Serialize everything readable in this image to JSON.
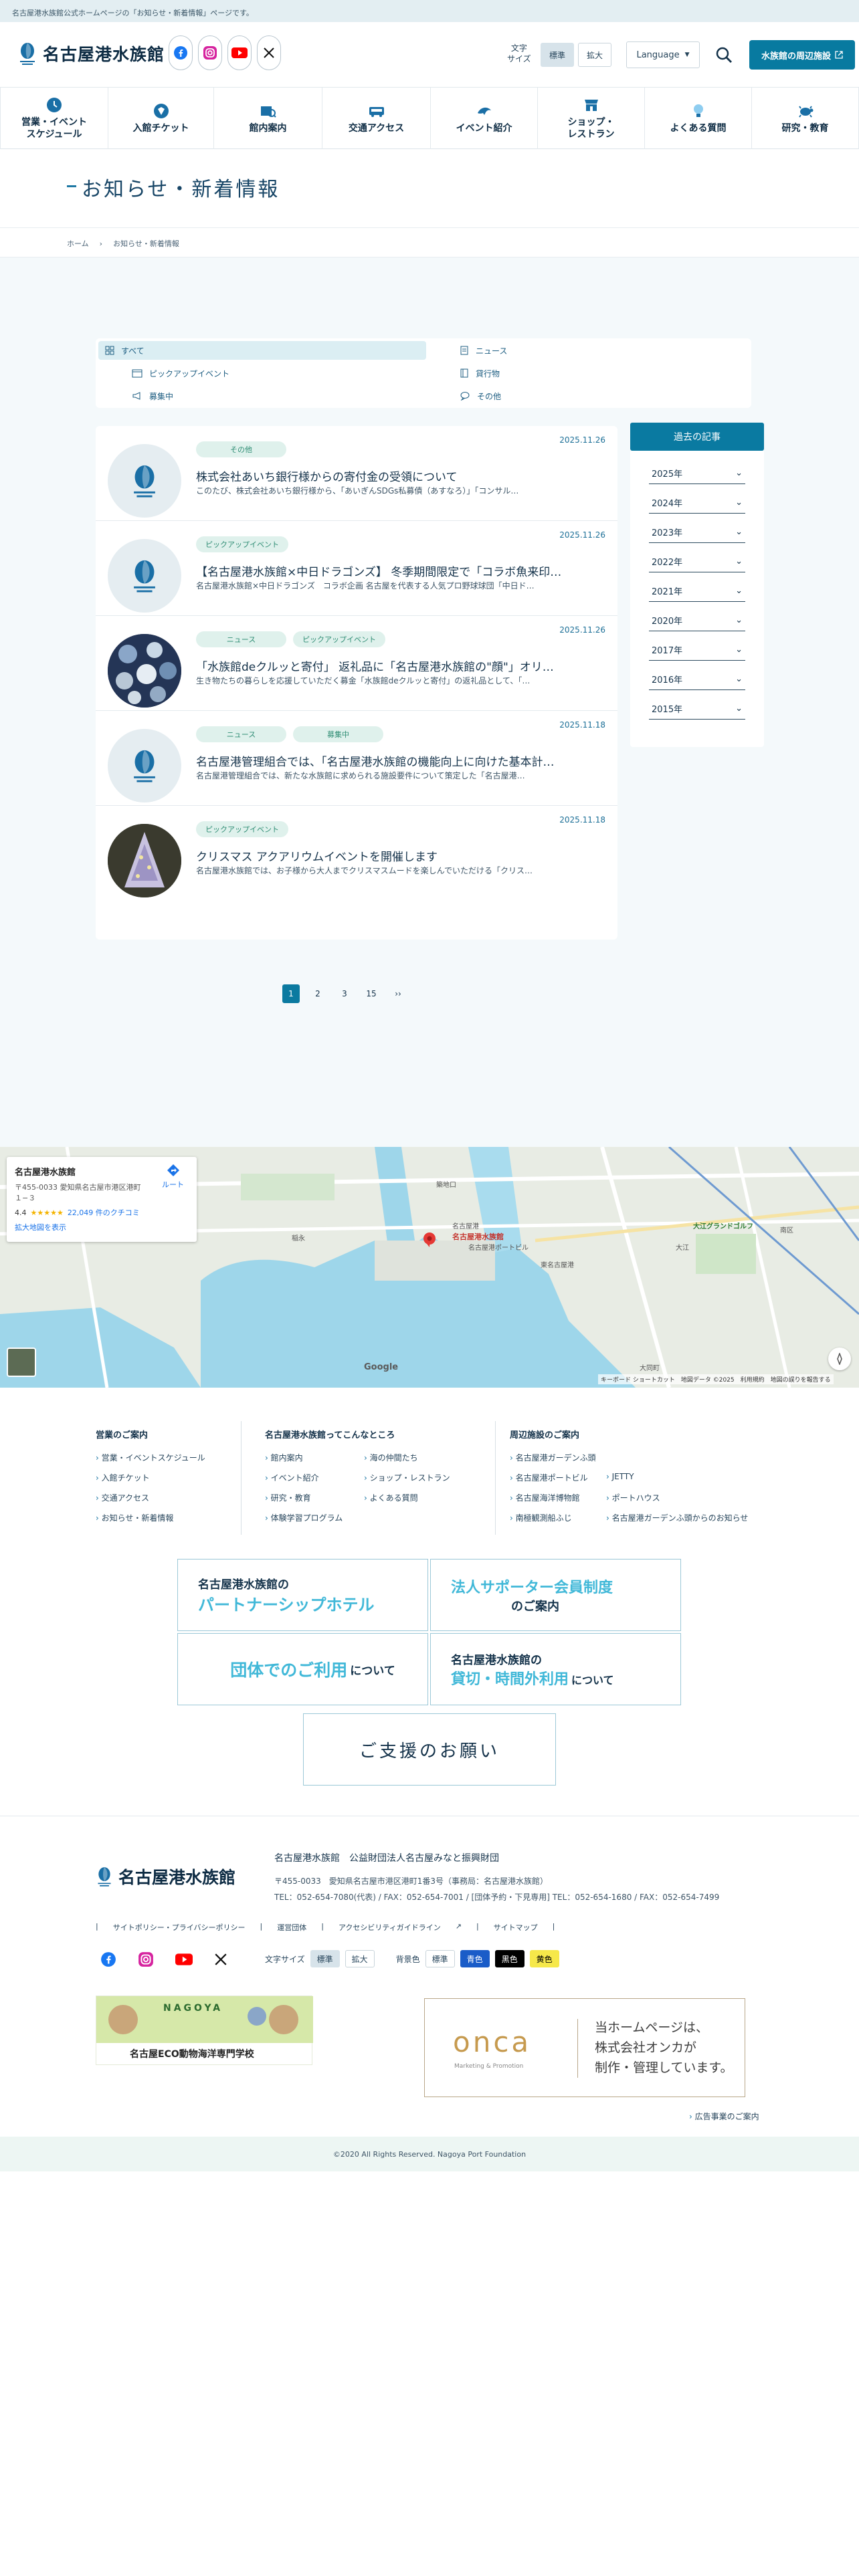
{
  "notice": "名古屋港水族館公式ホームページの「お知らせ・新着情報」ページです。",
  "header": {
    "logo_text": "名古屋港水族館",
    "font_size_label_1": "文字",
    "font_size_label_2": "サイズ",
    "font_size_standard": "標準",
    "font_size_large": "拡大",
    "language": "Language",
    "nearby": "水族館の周辺施設"
  },
  "nav": [
    {
      "l1": "営業・イベント",
      "l2": "スケジュール",
      "icon": "clock-icon"
    },
    {
      "l1": "入館チケット",
      "l2": "",
      "icon": "ticket-icon"
    },
    {
      "l1": "館内案内",
      "l2": "",
      "icon": "map-search-icon"
    },
    {
      "l1": "交通アクセス",
      "l2": "",
      "icon": "bus-icon"
    },
    {
      "l1": "イベント紹介",
      "l2": "",
      "icon": "dolphin-icon"
    },
    {
      "l1": "ショップ・",
      "l2": "レストラン",
      "icon": "shop-icon"
    },
    {
      "l1": "よくある質問",
      "l2": "",
      "icon": "lightbulb-icon"
    },
    {
      "l1": "研究・教育",
      "l2": "",
      "icon": "turtle-icon"
    }
  ],
  "page_title": "お知らせ・新着情報",
  "breadcrumb": [
    "ホーム",
    "お知らせ・新着情報"
  ],
  "filters": [
    {
      "label": "すべて",
      "icon": "grid-icon",
      "active": true
    },
    {
      "label": "ニュース",
      "icon": "document-icon",
      "active": false
    },
    {
      "label": "ピックアップイベント",
      "icon": "calendar-icon",
      "active": false
    },
    {
      "label": "貸行物",
      "icon": "book-icon",
      "active": false
    },
    {
      "label": "募集中",
      "icon": "megaphone-icon",
      "active": false
    },
    {
      "label": "その他",
      "icon": "chat-icon",
      "active": false
    }
  ],
  "articles": [
    {
      "date": "2025.11.26",
      "tags": [
        "その他"
      ],
      "title": "株式会社あいち銀行様からの寄付金の受領について",
      "excerpt": "このたび、株式会社あいち銀行様から、「あいぎんSDGs私募債（あすなろ）」「コンサル…",
      "thumb": "logo"
    },
    {
      "date": "2025.11.26",
      "tags": [
        "ピックアップイベント"
      ],
      "title": "【名古屋港水族館×中日ドラゴンズ】 冬季期間限定で「コラボ魚来印…",
      "excerpt": "名古屋港水族館×中日ドラゴンズ　コラボ企画 名古屋を代表する人気プロ野球球団「中日ド…",
      "thumb": "logo"
    },
    {
      "date": "2025.11.26",
      "tags": [
        "ニュース",
        "ピックアップイベント"
      ],
      "title": "「水族館deクルッと寄付」 返礼品に「名古屋港水族館の\"顔\"」オリ…",
      "excerpt": "生き物たちの暮らしを応援していただく募金「水族館deクルッと寄付」の返礼品として、「…",
      "thumb": "collage"
    },
    {
      "date": "2025.11.18",
      "tags": [
        "ニュース",
        "募集中"
      ],
      "title": "名古屋港管理組合では、「名古屋港水族館の機能向上に向けた基本計…",
      "excerpt": "名古屋港管理組合では、新たな水族館に求められる施設要件について策定した「名古屋港…",
      "thumb": "logo"
    },
    {
      "date": "2025.11.18",
      "tags": [
        "ピックアップイベント"
      ],
      "title": "クリスマス アクアリウムイベントを開催します",
      "excerpt": "名古屋港水族館では、お子様から大人までクリスマスムードを楽しんでいただける「クリス…",
      "thumb": "tree"
    }
  ],
  "archive": {
    "title": "過去の記事",
    "years": [
      "2025年",
      "2024年",
      "2023年",
      "2022年",
      "2021年",
      "2020年",
      "2017年",
      "2016年",
      "2015年"
    ]
  },
  "pagination": [
    "1",
    "2",
    "3",
    "15",
    "››"
  ],
  "map": {
    "card_title": "名古屋港水族館",
    "address": "〒455-0033 愛知県名古屋市港区港町",
    "address2": "１−３",
    "route": "ルート",
    "rating": "4.4",
    "stars": "★★★★★",
    "reviews": "22,049 件のクチコミ",
    "enlarge": "拡大地図を表示",
    "pin_label": "名古屋港水族館",
    "attribution": "キーボード ショートカット　地図データ ©2025　利用規約　地図の誤りを報告する",
    "google": "Google",
    "labels": [
      "名古屋港",
      "名古屋港ポートビル",
      "名古屋港水族館",
      "東名古屋港",
      "大江グランドゴルフ",
      "稲永",
      "築地口",
      "大江",
      "大同町",
      "南区"
    ]
  },
  "footer": {
    "col1": {
      "heading": "営業のご案内",
      "links": [
        "営業・イベントスケジュール",
        "入館チケット",
        "交通アクセス",
        "お知らせ・新着情報"
      ]
    },
    "col2": {
      "heading": "名古屋港水族館ってこんなところ",
      "links_a": [
        "館内案内",
        "イベント紹介",
        "研究・教育",
        "体験学習プログラム"
      ],
      "links_b": [
        "海の仲間たち",
        "ショップ・レストラン",
        "よくある質問"
      ]
    },
    "col3": {
      "heading": "周辺施設のご案内",
      "links_a": [
        "名古屋港ガーデンふ頭",
        "名古屋港ポートビル",
        "名古屋海洋博物館",
        "南極観測船ふじ"
      ],
      "links_b": [
        "JETTY",
        "ポートハウス",
        "名古屋港ガーデンふ頭からのお知らせ"
      ]
    },
    "banners": [
      {
        "l1": "名古屋港水族館の",
        "l2": "パートナーシップホテル",
        "l3": ""
      },
      {
        "l1": "法人サポーター会員制度",
        "l2": "のご案内",
        "l3": ""
      },
      {
        "l1": "団体でのご利用",
        "l2": "について",
        "l3": ""
      },
      {
        "l1": "名古屋港水族館の",
        "l2": "貸切・時間外利用",
        "l3": "について"
      },
      {
        "l1": "ご支援のお願い",
        "l2": "",
        "l3": ""
      }
    ]
  },
  "bottom": {
    "logo_text": "名古屋港水族館",
    "org": "名古屋港水族館　公益財団法人名古屋みなと振興財団",
    "address": "〒455-0033　愛知県名古屋市港区港町1番3号（事務局：名古屋港水族館）",
    "tel": "TEL：052-654-7080(代表) / FAX：052-654-7001 / [団体予約・下見専用] TEL：052-654-1680 / FAX：052-654-7499",
    "links": [
      "サイトポリシー・プライバシーポリシー",
      "運営団体",
      "アクセシビリティガイドライン",
      "サイトマップ"
    ],
    "font_label": "文字サイズ",
    "std": "標準",
    "large": "拡大",
    "bg_label": "背景色",
    "bg_std": "標準",
    "bg_blue": "青色",
    "bg_black": "黒色",
    "bg_yellow": "黄色",
    "eco_small": "NAGOYA",
    "eco_main": "名古屋ECO動物海洋専門学校",
    "onca_logo": "onca",
    "onca_sub": "Marketing & Promotion",
    "onca_text1": "当ホームページは、",
    "onca_text2": "株式会社オンカが",
    "onca_text3": "制作・管理しています。",
    "ad_link": "広告事業のご案内",
    "copyright": "©2020 All Rights Reserved. Nagoya Port Foundation"
  },
  "colors": {
    "primary": "#0a7aa1",
    "tag_bg": "#dff1ec",
    "tag_text": "#2f8d74",
    "main_bg": "#f4f9fb"
  }
}
